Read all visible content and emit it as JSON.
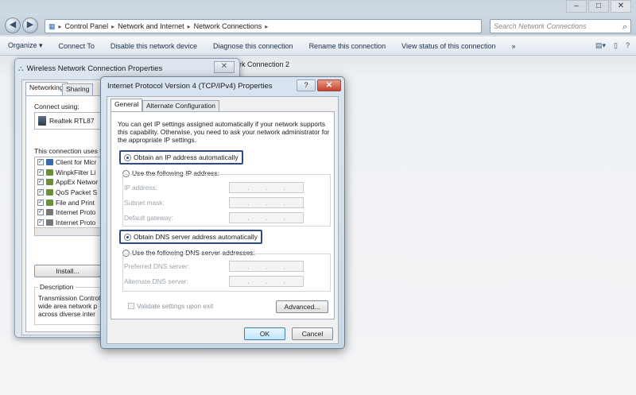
{
  "explorer": {
    "breadcrumbs": [
      "Control Panel",
      "Network and Internet",
      "Network Connections"
    ],
    "search_placeholder": "Search Network Connections",
    "toolbar": [
      "Organize ▾",
      "Connect To",
      "Disable this network device",
      "Diagnose this connection",
      "Rename this connection",
      "View status of this connection",
      "»"
    ],
    "background_label": "rk Connection 2",
    "window_controls": [
      "–",
      "□",
      "✕"
    ]
  },
  "wireless_props": {
    "title": "Wireless Network Connection Properties",
    "tabs": [
      "Networking",
      "Sharing"
    ],
    "connect_using_label": "Connect using:",
    "adapter_name": "Realtek RTL87",
    "uses_label": "This connection uses t",
    "items": [
      {
        "label": "Client for Micr",
        "checked": true
      },
      {
        "label": "WinpkFilter Li",
        "checked": true
      },
      {
        "label": "AppEx Networ",
        "checked": true
      },
      {
        "label": "QoS Packet S",
        "checked": true
      },
      {
        "label": "File and Print",
        "checked": true
      },
      {
        "label": "Internet Proto",
        "checked": true
      },
      {
        "label": "Internet Proto",
        "checked": true
      }
    ],
    "install_button": "Install...",
    "description_title": "Description",
    "description_text": "Transmission Control\nwide area network p\nacross diverse inter"
  },
  "ipv4": {
    "title": "Internet Protocol Version 4 (TCP/IPv4) Properties",
    "help_button": "?",
    "close_button": "✕",
    "tabs": [
      "General",
      "Alternate Configuration"
    ],
    "intro": "You can get IP settings assigned automatically if your network supports this capability. Otherwise, you need to ask your network administrator for the appropriate IP settings.",
    "ip_auto": "Obtain an IP address automatically",
    "ip_manual": "Use the following IP address:",
    "ip_fields": [
      "IP address:",
      "Subnet mask:",
      "Default gateway:"
    ],
    "dns_auto": "Obtain DNS server address automatically",
    "dns_manual": "Use the following DNS server addresses:",
    "dns_fields": [
      "Preferred DNS server:",
      "Alternate DNS server:"
    ],
    "validate": "Validate settings upon exit",
    "advanced_button": "Advanced...",
    "ok_button": "OK",
    "cancel_button": "Cancel",
    "ip_auto_selected": true,
    "dns_auto_selected": true
  }
}
